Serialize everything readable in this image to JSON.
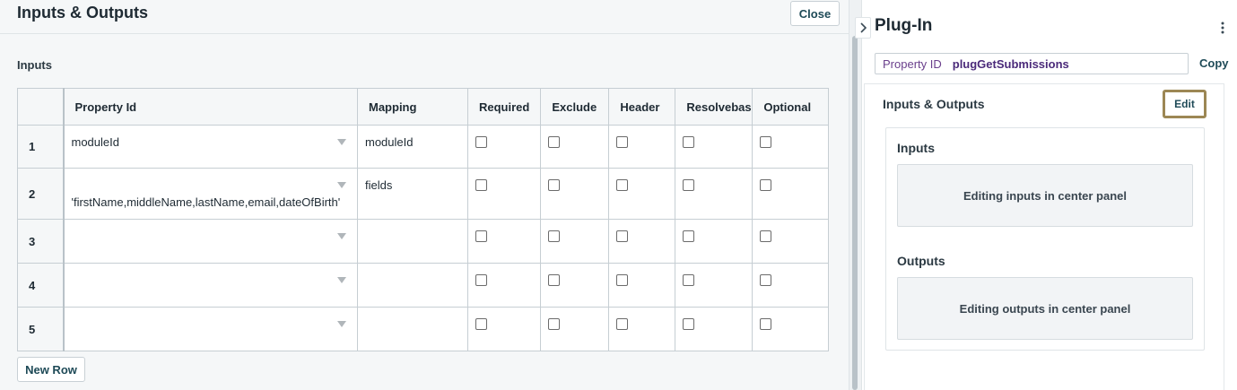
{
  "left_panel": {
    "title": "Inputs & Outputs",
    "close_label": "Close",
    "section_label": "Inputs",
    "new_row_label": "New Row",
    "table": {
      "columns": [
        "Property Id",
        "Mapping",
        "Required",
        "Exclude",
        "Header",
        "Resolvebas",
        "Optional"
      ],
      "rows": [
        {
          "num": "1",
          "property_id": "moduleId",
          "mapping": "moduleId",
          "required": false,
          "exclude": false,
          "header": false,
          "resolvebas": false,
          "optional": false
        },
        {
          "num": "2",
          "property_id": "'firstName,middleName,lastName,email,dateOfBirth'",
          "mapping": "fields",
          "required": false,
          "exclude": false,
          "header": false,
          "resolvebas": false,
          "optional": false
        },
        {
          "num": "3",
          "property_id": "",
          "mapping": "",
          "required": false,
          "exclude": false,
          "header": false,
          "resolvebas": false,
          "optional": false
        },
        {
          "num": "4",
          "property_id": "",
          "mapping": "",
          "required": false,
          "exclude": false,
          "header": false,
          "resolvebas": false,
          "optional": false
        },
        {
          "num": "5",
          "property_id": "",
          "mapping": "",
          "required": false,
          "exclude": false,
          "header": false,
          "resolvebas": false,
          "optional": false
        }
      ]
    }
  },
  "right_panel": {
    "title": "Plug-In",
    "collapse_icon": "chevron-right-icon",
    "menu_icon": "kebab-menu-icon",
    "property_id_label": "Property ID",
    "property_id_value": "plugGetSubmissions",
    "copy_label": "Copy",
    "io_title": "Inputs & Outputs",
    "edit_label": "Edit",
    "inputs_label": "Inputs",
    "inputs_message": "Editing inputs in center panel",
    "outputs_label": "Outputs",
    "outputs_message": "Editing outputs in center panel"
  },
  "colors": {
    "accent_text": "#1e4a57",
    "property_id_purple": "#4b2a7a",
    "edit_focus_border": "#9c8754",
    "panel_bg": "#f5f7f8"
  }
}
